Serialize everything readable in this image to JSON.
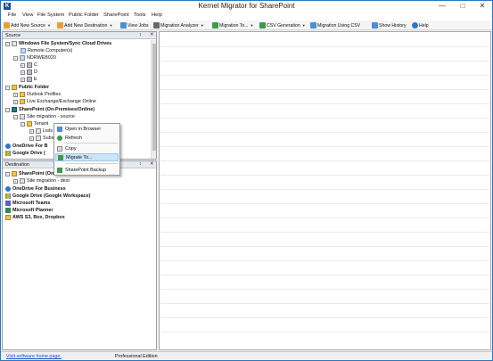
{
  "window": {
    "title": "Kernel Migrator for SharePoint",
    "icon_letter": "K"
  },
  "window_controls": {
    "minimize": "—",
    "maximize": "□",
    "close": "✕"
  },
  "menu": [
    "File",
    "View",
    "File System",
    "Public Folder",
    "SharePoint",
    "Tools",
    "Help"
  ],
  "toolbar": {
    "add_source": "Add New Source",
    "add_destination": "Add New Destination",
    "view_jobs": "View Jobs",
    "migration_analyzer": "Migration Analyzer",
    "migration_to": "Migration To...",
    "csv_generation": "CSV Generation",
    "migration_csv": "Migration Using CSV",
    "show_history": "Show History",
    "help": "Help"
  },
  "source_pane": {
    "title": "Source",
    "pin": "↕",
    "close": "✕",
    "tree": {
      "win_fs": "Windows File System/Sync Cloud Drives",
      "remote": "Remote Computer(s)",
      "computer": "NDRWEB020",
      "drive_c": "C",
      "drive_d": "D",
      "drive_e": "E",
      "public_folder": "Public Folder",
      "outlook_profiles": "Outlook Profiles",
      "live_exchange": "Live Exchange/Exchange Online",
      "sharepoint": "SharePoint (On-Premises/Online)",
      "site_source": "Site migration - source",
      "tenant": "Tenant",
      "lists": "Lists",
      "subsites": "Subs",
      "onedrive": "OneDrive For B",
      "googledrive": "Google Drive ("
    }
  },
  "destination_pane": {
    "title": "Destination",
    "pin": "↕",
    "close": "✕",
    "tree": {
      "sharepoint": "SharePoint (On-P",
      "site_dest": "Site migration - dest",
      "onedrive": "OneDrive For Business",
      "googledrive": "Google Drive (Google Workspace)",
      "teams": "Microsoft Teams",
      "planner": "Microsoft Planner",
      "aws": "AWS S3, Box, Dropbox"
    }
  },
  "context_menu": {
    "open_browser": "Open in Browser",
    "refresh": "Refresh",
    "copy": "Copy",
    "migrate_to": "Migrate To...",
    "sp_backup": "SharePoint Backup"
  },
  "status": {
    "link": "Visit software home page.",
    "edition": "Professional Edition"
  },
  "colors": {
    "accent": "#2b78c5",
    "highlight": "#cce4f7",
    "link": "#1a4fcf"
  }
}
